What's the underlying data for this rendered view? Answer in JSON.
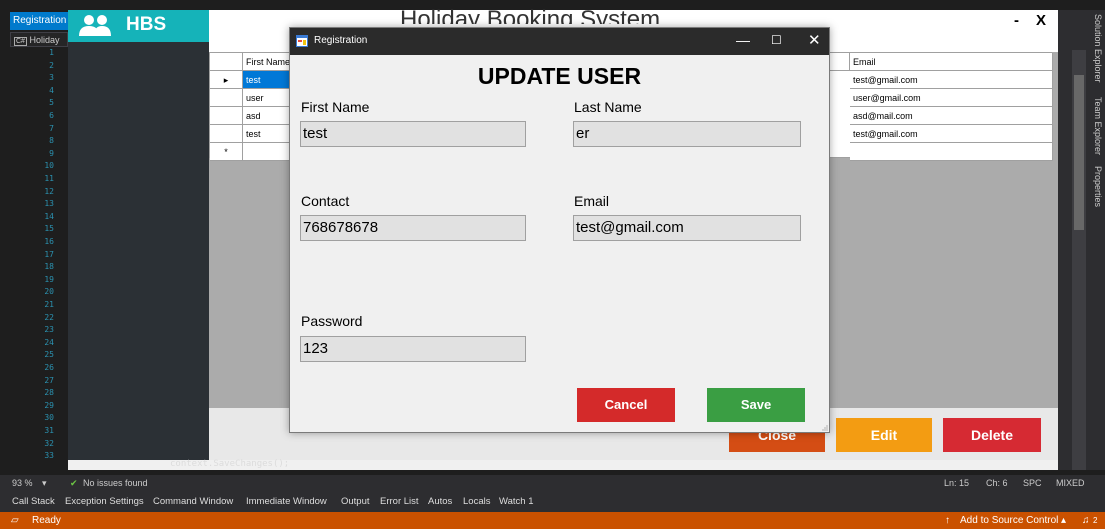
{
  "vs": {
    "tab_label": "Registration",
    "file_label": "Holiday",
    "file_icon": "C#",
    "line_numbers": [
      "1",
      "2",
      "3",
      "4",
      "5",
      "6",
      "7",
      "8",
      "9",
      "10",
      "11",
      "12",
      "13",
      "14",
      "15",
      "16",
      "17",
      "18",
      "19",
      "20",
      "21",
      "22",
      "23",
      "24",
      "25",
      "26",
      "27",
      "28",
      "29",
      "30",
      "31",
      "32",
      "33"
    ],
    "code_line": "context.SaveChanges();",
    "zoom": "93 %",
    "issues": "No issues found",
    "position": "Ln: 15",
    "char": "Ch: 6",
    "spc": "SPC",
    "mixed": "MIXED",
    "tool_tabs": [
      "Call Stack",
      "Exception Settings",
      "Command Window",
      "Immediate Window",
      "Output",
      "Error List",
      "Autos",
      "Locals",
      "Watch 1"
    ],
    "status": "Ready",
    "source_control": "Add to Source Control",
    "notifications": "2",
    "side_tabs": [
      "Solution Explorer",
      "Team Explorer",
      "Properties"
    ]
  },
  "app": {
    "brand": "HBS",
    "title": "Holiday Booking System",
    "min": "-",
    "close": "X",
    "grid": {
      "columns": [
        "First Name",
        "Email"
      ],
      "rows": [
        {
          "first_name": "test",
          "email": "test@gmail.com"
        },
        {
          "first_name": "user",
          "email": "user@gmail.com"
        },
        {
          "first_name": "asd",
          "email": "asd@mail.com"
        },
        {
          "first_name": "test",
          "email": "test@gmail.com"
        }
      ],
      "new_row_marker": "*",
      "current_row_marker": "▸"
    },
    "buttons": {
      "close": "Close",
      "edit": "Edit",
      "delete": "Delete"
    }
  },
  "dialog": {
    "title": "Registration",
    "heading": "UPDATE USER",
    "labels": {
      "first_name": "First Name",
      "last_name": "Last Name",
      "contact": "Contact",
      "email": "Email",
      "password": "Password"
    },
    "values": {
      "first_name": "test",
      "last_name": "er",
      "contact": "768678678",
      "email": "test@gmail.com",
      "password": "123"
    },
    "buttons": {
      "cancel": "Cancel",
      "save": "Save"
    },
    "window_controls": {
      "minimize": "—",
      "maximize": "☐",
      "close": "✕"
    }
  },
  "colors": {
    "brand": "#15b3b9",
    "cancel": "#d42a2a",
    "save": "#3a9e43",
    "close_btn": "#d44d14",
    "edit_btn": "#f39c12",
    "delete_btn": "#d62a33",
    "status_bar": "#ca5100"
  }
}
